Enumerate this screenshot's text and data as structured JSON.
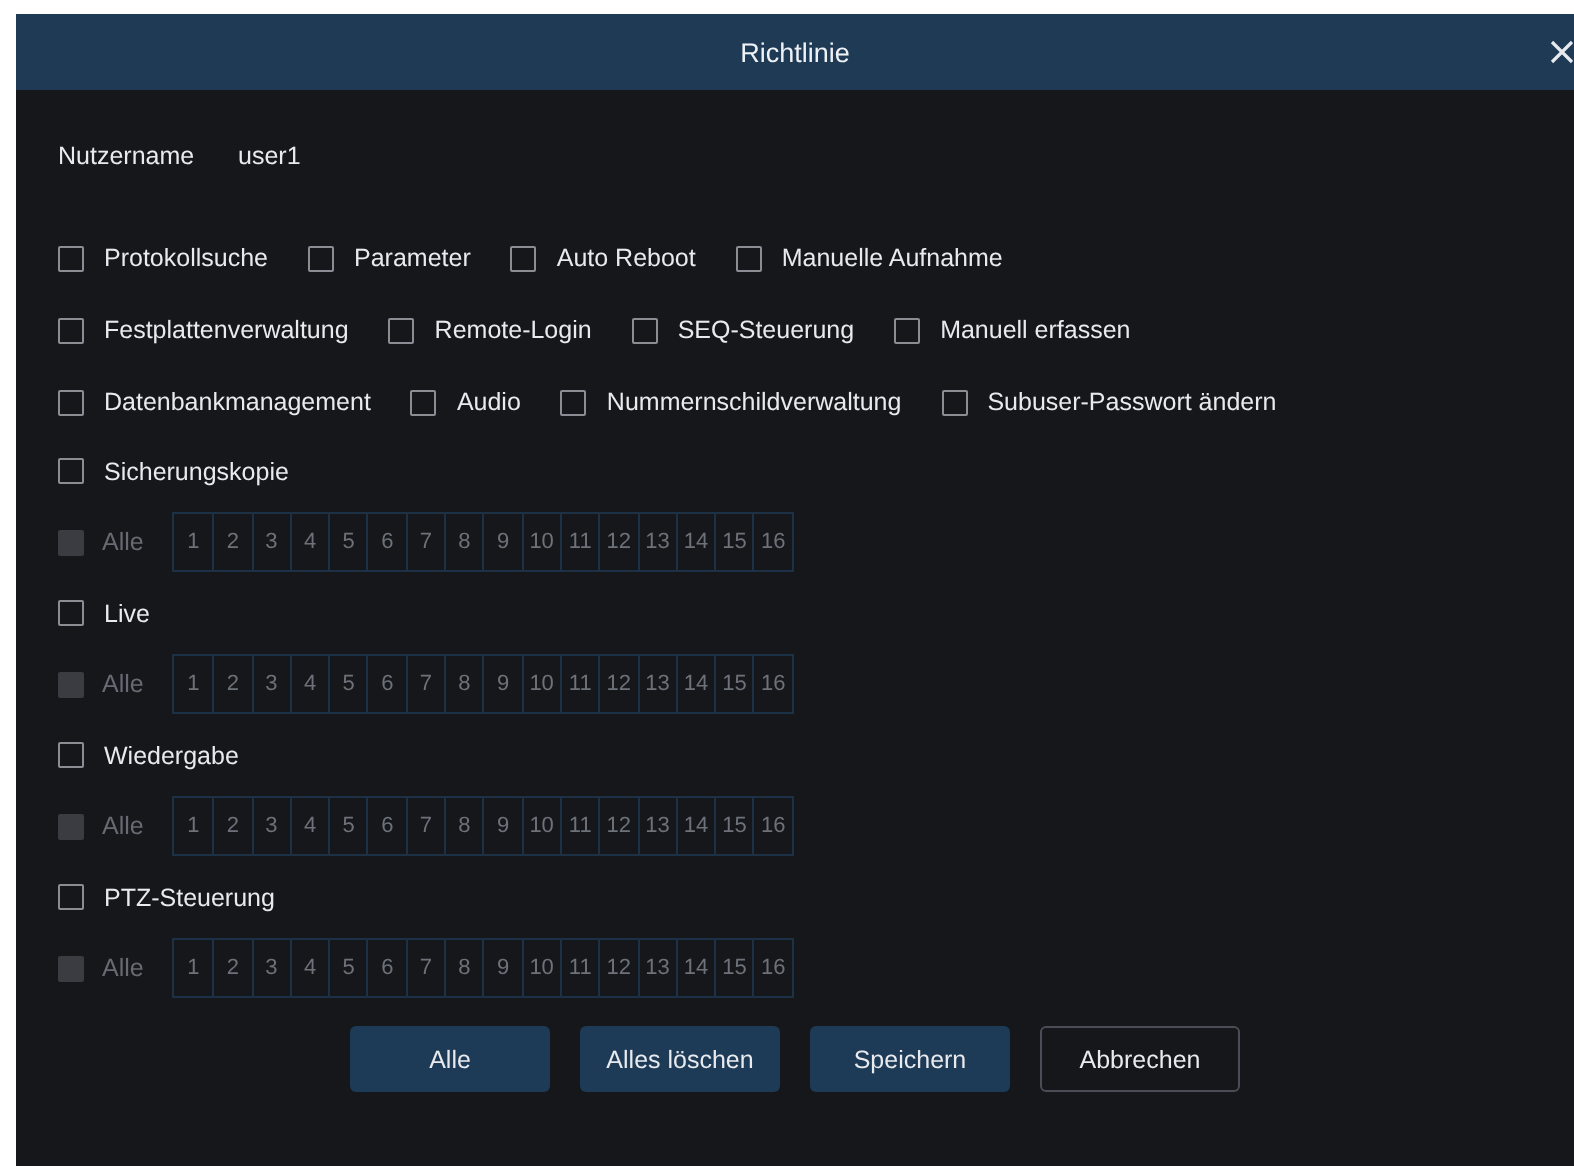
{
  "dialog": {
    "title": "Richtlinie"
  },
  "user": {
    "label": "Nutzername",
    "value": "user1"
  },
  "permissions": [
    [
      {
        "label": "Protokollsuche",
        "checked": false
      },
      {
        "label": "Parameter",
        "checked": false
      },
      {
        "label": "Auto Reboot",
        "checked": false
      },
      {
        "label": "Manuelle Aufnahme",
        "checked": false
      }
    ],
    [
      {
        "label": "Festplattenverwaltung",
        "checked": false
      },
      {
        "label": "Remote-Login",
        "checked": false
      },
      {
        "label": "SEQ-Steuerung",
        "checked": false
      },
      {
        "label": "Manuell erfassen",
        "checked": false
      }
    ],
    [
      {
        "label": "Datenbankmanagement",
        "checked": false
      },
      {
        "label": "Audio",
        "checked": false
      },
      {
        "label": "Nummernschildverwaltung",
        "checked": false
      },
      {
        "label": "Subuser-Passwort ändern",
        "checked": false
      }
    ]
  ],
  "sections": [
    {
      "label": "Sicherungskopie",
      "checked": false,
      "all": {
        "label": "Alle",
        "checked": false,
        "disabled": true
      },
      "channels": [
        "1",
        "2",
        "3",
        "4",
        "5",
        "6",
        "7",
        "8",
        "9",
        "10",
        "11",
        "12",
        "13",
        "14",
        "15",
        "16"
      ]
    },
    {
      "label": "Live",
      "checked": false,
      "all": {
        "label": "Alle",
        "checked": false,
        "disabled": true
      },
      "channels": [
        "1",
        "2",
        "3",
        "4",
        "5",
        "6",
        "7",
        "8",
        "9",
        "10",
        "11",
        "12",
        "13",
        "14",
        "15",
        "16"
      ]
    },
    {
      "label": "Wiedergabe",
      "checked": false,
      "all": {
        "label": "Alle",
        "checked": false,
        "disabled": true
      },
      "channels": [
        "1",
        "2",
        "3",
        "4",
        "5",
        "6",
        "7",
        "8",
        "9",
        "10",
        "11",
        "12",
        "13",
        "14",
        "15",
        "16"
      ]
    },
    {
      "label": "PTZ-Steuerung",
      "checked": false,
      "all": {
        "label": "Alle",
        "checked": false,
        "disabled": true
      },
      "channels": [
        "1",
        "2",
        "3",
        "4",
        "5",
        "6",
        "7",
        "8",
        "9",
        "10",
        "11",
        "12",
        "13",
        "14",
        "15",
        "16"
      ]
    }
  ],
  "buttons": [
    {
      "label": "Alle",
      "kind": "primary"
    },
    {
      "label": "Alles löschen",
      "kind": "primary"
    },
    {
      "label": "Speichern",
      "kind": "primary"
    },
    {
      "label": "Abbrechen",
      "kind": "outline"
    }
  ]
}
